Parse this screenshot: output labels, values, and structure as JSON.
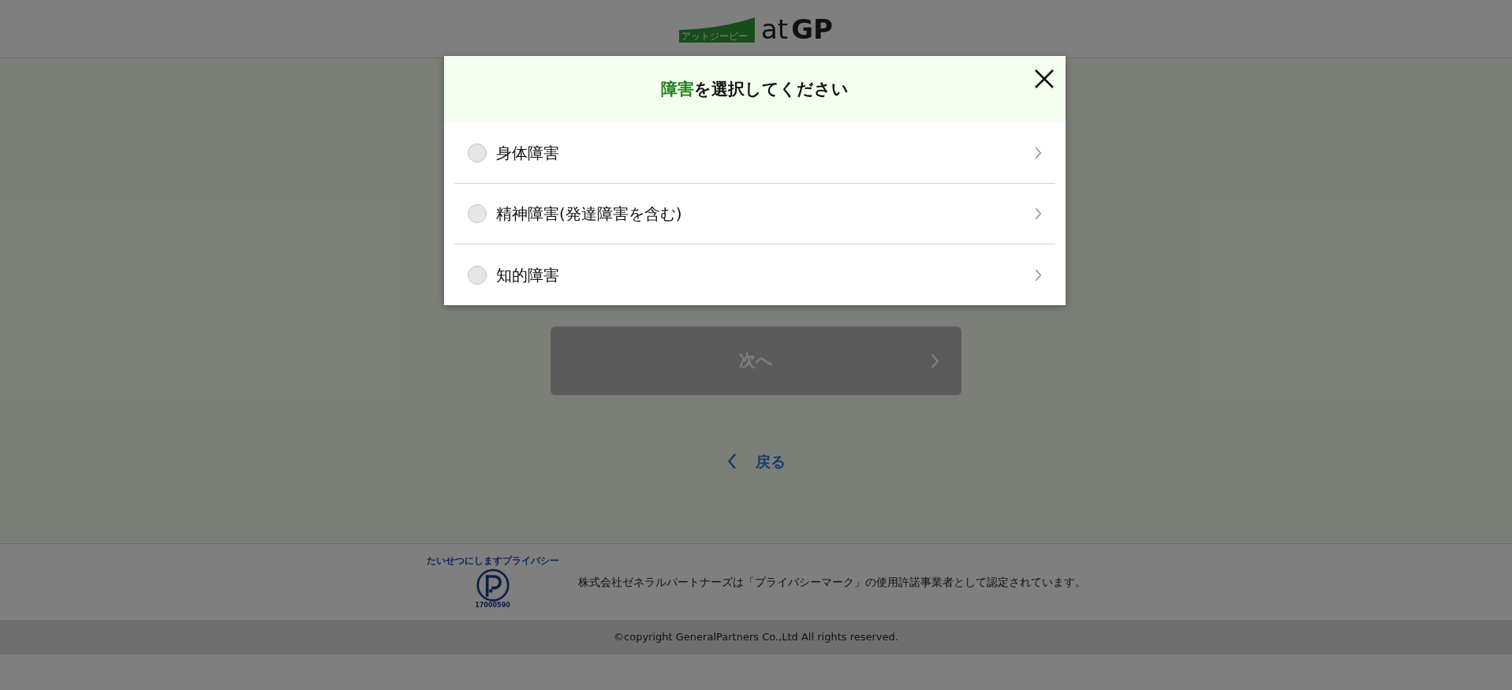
{
  "logo": {
    "tagline": "アットジーピー",
    "wordmark_light": "at",
    "wordmark_bold": "GP"
  },
  "next_button": {
    "label": "次へ",
    "disabled": true
  },
  "back_link": {
    "label": "戻る"
  },
  "footer": {
    "privacy_mark": {
      "caption": "たいせつにしますプライバシー",
      "number": "17000590"
    },
    "notice": "株式会社ゼネラルパートナーズは「プライバシーマーク」の使用許諾事業者として認定されています。",
    "copyright": "©copyright GeneralPartners Co.,Ltd All rights reserved."
  },
  "modal": {
    "title_highlight": "障害",
    "title_rest": "を選択してください",
    "options": [
      {
        "label": "身体障害",
        "selected": false
      },
      {
        "label": "精神障害(発達障害を含む)",
        "selected": false
      },
      {
        "label": "知的障害",
        "selected": false
      }
    ]
  }
}
